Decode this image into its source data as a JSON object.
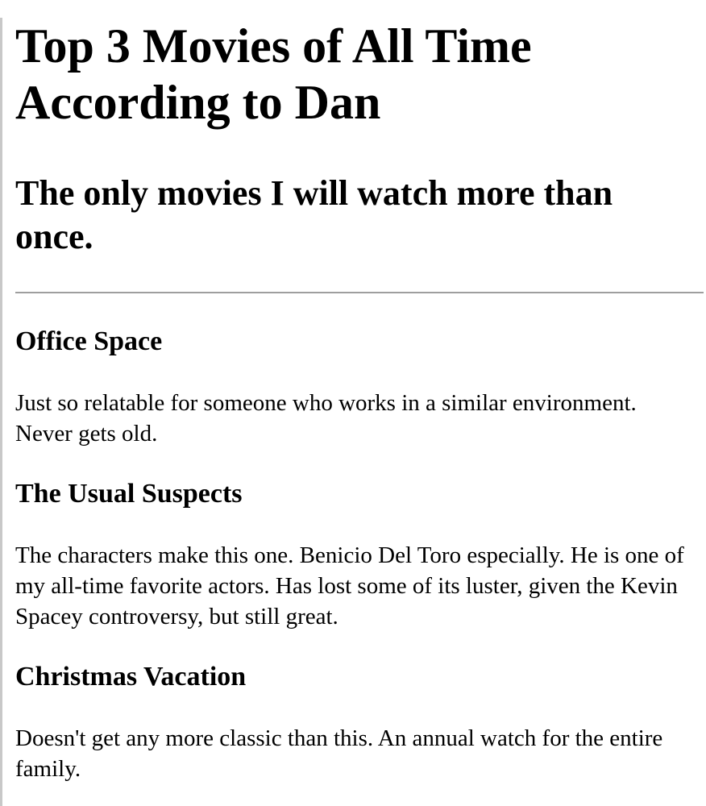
{
  "page": {
    "title": "Top 3 Movies of All Time According to Dan",
    "subtitle": "The only movies I will watch more than once."
  },
  "movies": [
    {
      "title": "Office Space",
      "description": "Just so relatable for someone who works in a similar environment. Never gets old."
    },
    {
      "title": "The Usual Suspects",
      "description": "The characters make this one. Benicio Del Toro especially. He is one of my all-time favorite actors. Has lost some of its luster, given the Kevin Spacey controversy, but still great."
    },
    {
      "title": "Christmas Vacation",
      "description": "Doesn't get any more classic than this. An annual watch for the entire family."
    }
  ]
}
